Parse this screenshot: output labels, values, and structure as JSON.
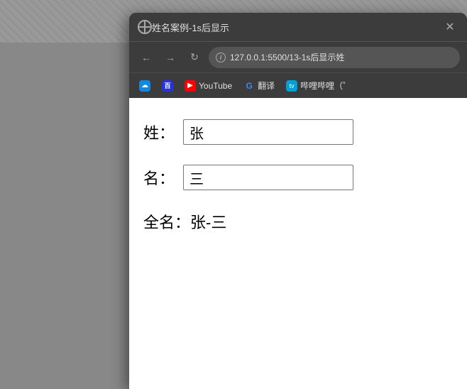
{
  "background": {
    "color": "#888"
  },
  "browser": {
    "titlebar": {
      "title": "姓名案例-1s后显示",
      "close_label": "✕"
    },
    "navbar": {
      "back_label": "←",
      "forward_label": "→",
      "reload_label": "↻",
      "address": "127.0.0.1:5500/13-1s后显示姓",
      "info_label": "i"
    },
    "bookmarks": [
      {
        "id": "baiduyun",
        "label": "",
        "icon_text": "☁"
      },
      {
        "id": "baidu",
        "label": "",
        "icon_text": "百"
      },
      {
        "id": "youtube",
        "label": "YouTube",
        "icon_text": "▶"
      },
      {
        "id": "translate",
        "label": "翻译",
        "icon_text": "G"
      },
      {
        "id": "bilibili",
        "label": "哔哩哔哩（゜",
        "icon_text": "tv"
      }
    ]
  },
  "page": {
    "surname_label": "姓：",
    "surname_value": "张",
    "surname_placeholder": "",
    "firstname_label": "名：",
    "firstname_value": "三",
    "firstname_placeholder": "",
    "fullname_label": "全名：",
    "fullname_value": "张-三"
  }
}
